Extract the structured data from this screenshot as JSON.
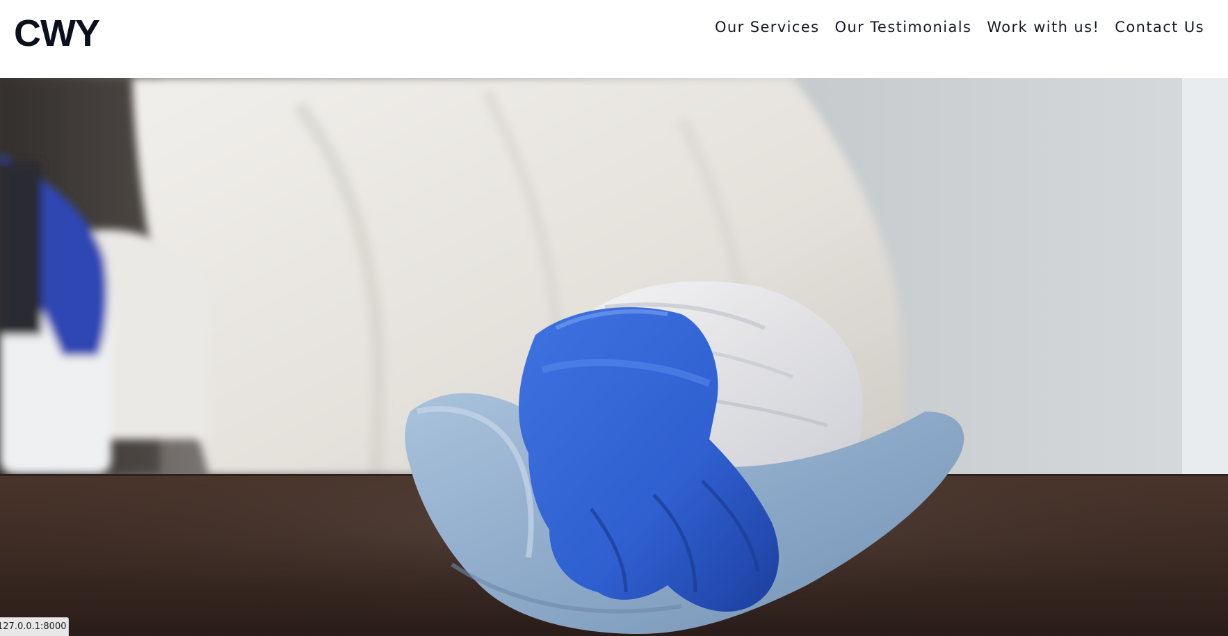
{
  "header": {
    "logo": "CWY"
  },
  "nav": {
    "items": [
      {
        "label": "Our Services"
      },
      {
        "label": "Our Testimonials"
      },
      {
        "label": "Work with us!"
      },
      {
        "label": "Contact Us"
      }
    ]
  },
  "hero": {
    "image_subject": "gloved-hand-wiping-table-photo"
  },
  "status": {
    "url": "127.0.0.1:8000"
  },
  "colors": {
    "brand_text": "#0b0f1e",
    "nav_text": "#151726",
    "glove_blue": "#2f5fd0"
  }
}
